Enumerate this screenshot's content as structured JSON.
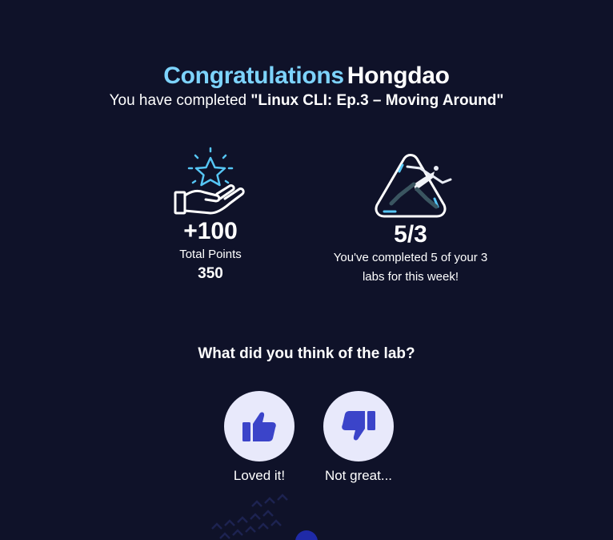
{
  "header": {
    "congrats": "Congratulations",
    "username": "Hongdao",
    "completed_prefix": "You have completed",
    "lab_title": "\"Linux CLI: Ep.3 – Moving Around\""
  },
  "points": {
    "gained": "+100",
    "total_label": "Total Points",
    "total_value": "350",
    "icon": "star-hand-icon"
  },
  "weekly": {
    "ratio": "5/3",
    "line1": "You've completed 5 of your 3",
    "line2": "labs for this week!",
    "icon": "runner-triangle-icon"
  },
  "feedback": {
    "question": "What did you think of the lab?",
    "positive_label": "Loved it!",
    "negative_label": "Not great..."
  },
  "colors": {
    "background": "#0f1229",
    "accent": "#7dd3fc",
    "button_bg": "#e8e9fb",
    "thumb": "#3b44c9"
  }
}
